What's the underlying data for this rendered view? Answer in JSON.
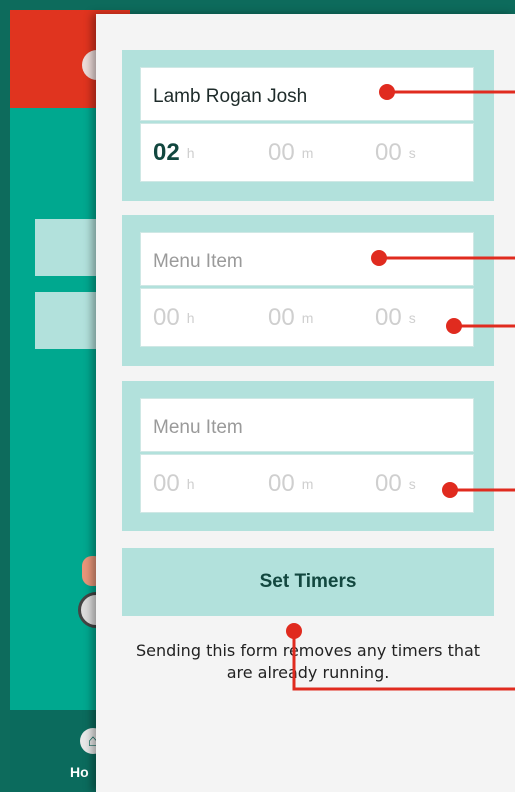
{
  "background_app": {
    "tab_home_label": "Ho"
  },
  "items": [
    {
      "name": "Lamb Rogan Josh",
      "name_is_placeholder": false,
      "hours": "02",
      "hours_set": true,
      "minutes": "00",
      "seconds": "00"
    },
    {
      "name": "Menu Item",
      "name_is_placeholder": true,
      "hours": "00",
      "hours_set": false,
      "minutes": "00",
      "seconds": "00"
    },
    {
      "name": "Menu Item",
      "name_is_placeholder": true,
      "hours": "00",
      "hours_set": false,
      "minutes": "00",
      "seconds": "00"
    }
  ],
  "units": {
    "h": "h",
    "m": "m",
    "s": "s"
  },
  "set_button_label": "Set Timers",
  "note_text": "Sending this form removes any timers that are already running.",
  "colors": {
    "accent_red": "#e0341f",
    "teal_dark": "#0d6b5c",
    "teal_light": "#b2e1dc",
    "teal": "#00a88f",
    "annotation": "#e02b1f"
  }
}
